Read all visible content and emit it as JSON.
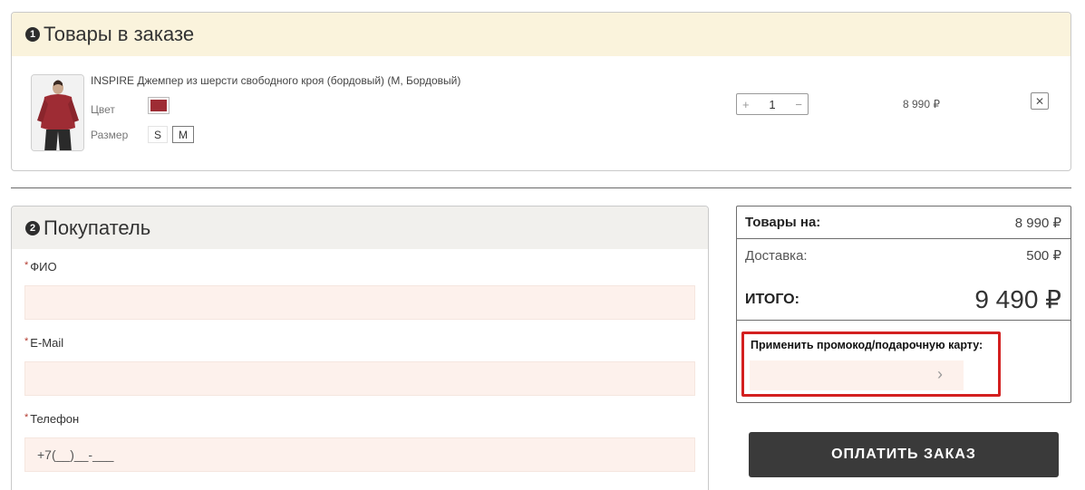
{
  "items_section": {
    "step": "1",
    "title": "Товары в заказе",
    "product": {
      "name": "INSPIRE Джемпер из шерсти свободного кроя (бордовый) (M, Бордовый)",
      "color_label": "Цвет",
      "color_hex": "#9e2c34",
      "size_label": "Размер",
      "sizes": [
        "S",
        "M"
      ],
      "selected_size": "M",
      "qty_plus": "+",
      "qty_value": "1",
      "qty_minus": "−",
      "price": "8 990 ₽",
      "remove": "✕"
    }
  },
  "buyer_section": {
    "step": "2",
    "title": "Покупатель",
    "req_mark": "*",
    "fields": [
      {
        "label": "ФИО",
        "value": ""
      },
      {
        "label": "E-Mail",
        "value": ""
      },
      {
        "label": "Телефон",
        "placeholder": "+7(__)__-___"
      }
    ]
  },
  "summary": {
    "items_label": "Товары на:",
    "items_value": "8 990 ₽",
    "delivery_label": "Доставка:",
    "delivery_value": "500 ₽",
    "total_label": "ИТОГО:",
    "total_value": "9 490 ₽",
    "promo_label": "Применить промокод/подарочную карту:",
    "promo_arrow": "›"
  },
  "pay_button": "ОПЛАТИТЬ ЗАКАЗ",
  "colors": {
    "header_yellow": "#faf3dc",
    "input_bg": "#fdf1ec",
    "highlight_red": "#d32020",
    "pay_button": "#3a3a3a"
  }
}
